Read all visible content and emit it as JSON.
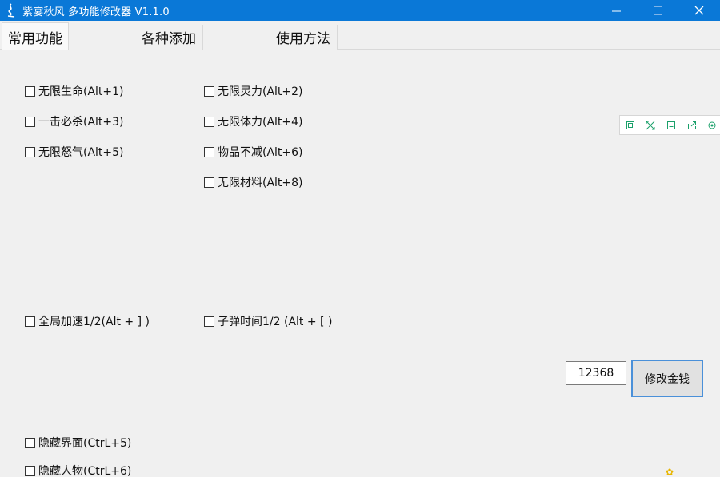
{
  "window": {
    "title": "紫宴秋风 多功能修改器 V1.1.0",
    "app_icon": "calligraphy-logo-icon",
    "controls": [
      "minimize-icon",
      "maximize-icon",
      "close-icon"
    ]
  },
  "tabs": [
    {
      "label": "常用功能",
      "active": true
    },
    {
      "label": "各种添加",
      "active": false
    },
    {
      "label": "使用方法",
      "active": false
    }
  ],
  "checkboxes": {
    "c1": "无限生命(Alt+1)",
    "c2": "无限灵力(Alt+2)",
    "c3": "一击必杀(Alt+3)",
    "c4": "无限体力(Alt+4)",
    "c5": "无限怒气(Alt+5)",
    "c6": "物品不减(Alt+6)",
    "c7": "无限材料(Alt+8)",
    "c8": "全局加速1/2(Alt + ] )",
    "c9": "子弹时间1/2 (Alt + [ )",
    "c10": "隐藏界面(CtrL+5)",
    "c11": "隐藏人物(CtrL+6)"
  },
  "money": {
    "value": "12368",
    "button_label": "修改金钱"
  },
  "floating_toolbar": {
    "icons": [
      "copy-icon",
      "crop-icon",
      "save-icon",
      "share-icon",
      "settings-icon"
    ],
    "accent_color": "#1aa06a"
  },
  "colors": {
    "titlebar": "#0a78d7",
    "accent_border": "#4a90d9"
  }
}
